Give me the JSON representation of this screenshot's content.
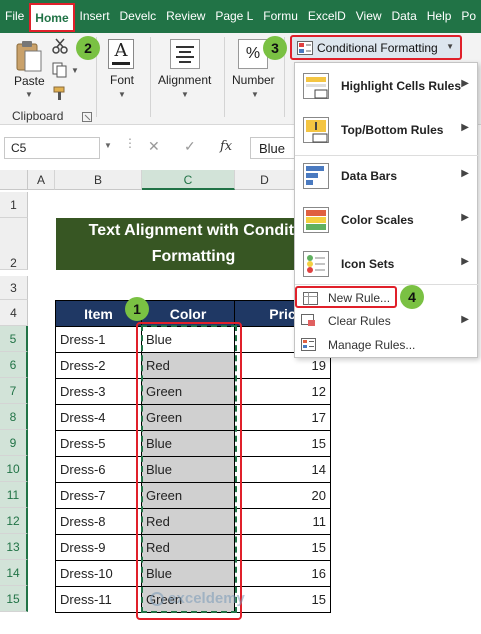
{
  "ribbon_tabs": [
    "File",
    "Home",
    "Insert",
    "Develc",
    "Review",
    "Page L",
    "Formu",
    "ExcelD",
    "View",
    "Data",
    "Help",
    "Po"
  ],
  "ribbon": {
    "paste_label": "Paste",
    "clipboard_label": "Clipboard",
    "font_label": "Font",
    "alignment_label": "Alignment",
    "number_label": "Number",
    "percent_symbol": "%",
    "font_letter": "A",
    "cf_button_label": "Conditional Formatting"
  },
  "formula_bar": {
    "name_box": "C5",
    "fx_symbol": "fx",
    "value": "Blue"
  },
  "columns": [
    "A",
    "B",
    "C",
    "D"
  ],
  "rows": [
    "1",
    "2",
    "3",
    "4",
    "5",
    "6",
    "7",
    "8",
    "9",
    "10",
    "11",
    "12",
    "13",
    "14",
    "15"
  ],
  "sheet": {
    "title_line1": "Text Alignment with Conditi",
    "title_line2": "Formatting",
    "headers": [
      "Item",
      "Color",
      "Pric"
    ],
    "data_rows": [
      {
        "item": "Dress-1",
        "color": "Blue",
        "price": ""
      },
      {
        "item": "Dress-2",
        "color": "Red",
        "price": "19"
      },
      {
        "item": "Dress-3",
        "color": "Green",
        "price": "12"
      },
      {
        "item": "Dress-4",
        "color": "Green",
        "price": "17"
      },
      {
        "item": "Dress-5",
        "color": "Blue",
        "price": "15"
      },
      {
        "item": "Dress-6",
        "color": "Blue",
        "price": "14"
      },
      {
        "item": "Dress-7",
        "color": "Green",
        "price": "20"
      },
      {
        "item": "Dress-8",
        "color": "Red",
        "price": "11"
      },
      {
        "item": "Dress-9",
        "color": "Red",
        "price": "15"
      },
      {
        "item": "Dress-10",
        "color": "Blue",
        "price": "16"
      },
      {
        "item": "Dress-11",
        "color": "Green",
        "price": "15"
      }
    ]
  },
  "menu": {
    "highlight": "Highlight Cells Rules",
    "topbottom": "Top/Bottom Rules",
    "databars": "Data Bars",
    "colorscales": "Color Scales",
    "iconsets": "Icon Sets",
    "newrule": "New Rule...",
    "clearrules": "Clear Rules",
    "managerules": "Manage Rules..."
  },
  "badges": [
    "1",
    "2",
    "3",
    "4"
  ],
  "watermark": "exceldemy",
  "colors": {
    "excel_green": "#217346",
    "title_fill": "#375623",
    "header_fill": "#1f3864",
    "highlight_red": "#e0202a",
    "badge_green": "#7ac143"
  }
}
